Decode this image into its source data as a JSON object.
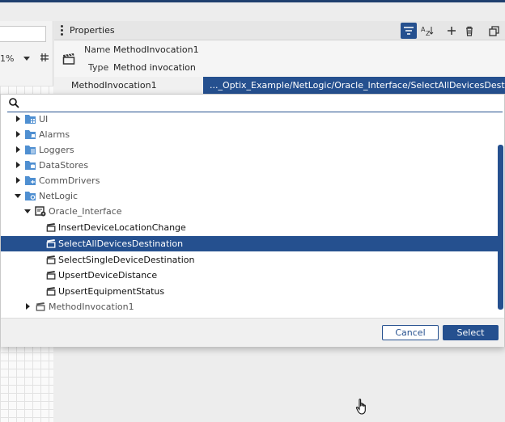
{
  "left_panel": {
    "zoom_value": "1%",
    "grid_toggle_icon": "grid-snap-icon"
  },
  "properties": {
    "header_title": "Properties",
    "toolbar_icons": [
      "filter-icon",
      "sort-az-icon",
      "add-icon",
      "delete-icon",
      "copy-icon"
    ],
    "name_label": "Name",
    "name_value": "MethodInvocation1",
    "type_label": "Type",
    "type_value": "Method invocation",
    "selected_row_label": "MethodInvocation1",
    "selected_row_value": "..._Optix_Example/NetLogic/Oracle_Interface/SelectAllDevicesDestination"
  },
  "dialog": {
    "search_value": "",
    "tree": [
      {
        "label": "UI",
        "icon": "folder-ui-icon",
        "expanded": false
      },
      {
        "label": "Alarms",
        "icon": "folder-alarms-icon",
        "expanded": false
      },
      {
        "label": "Loggers",
        "icon": "folder-loggers-icon",
        "expanded": false
      },
      {
        "label": "DataStores",
        "icon": "folder-datastores-icon",
        "expanded": false
      },
      {
        "label": "CommDrivers",
        "icon": "folder-commdrivers-icon",
        "expanded": false
      },
      {
        "label": "NetLogic",
        "icon": "folder-netlogic-icon",
        "expanded": true
      },
      {
        "label": "Oracle_Interface",
        "icon": "netlogic-object-icon",
        "expanded": true
      },
      {
        "label": "InsertDeviceLocationChange",
        "icon": "method-icon"
      },
      {
        "label": "SelectAllDevicesDestination",
        "icon": "method-icon",
        "selected": true
      },
      {
        "label": "SelectSingleDeviceDestination",
        "icon": "method-icon"
      },
      {
        "label": "UpsertDeviceDistance",
        "icon": "method-icon"
      },
      {
        "label": "UpsertEquipmentStatus",
        "icon": "method-icon"
      },
      {
        "label": "MethodInvocation1",
        "icon": "method-icon",
        "expanded": false
      }
    ],
    "cancel_label": "Cancel",
    "select_label": "Select"
  },
  "colors": {
    "accent": "#25508f",
    "folder_blue": "#4f8fd1"
  }
}
